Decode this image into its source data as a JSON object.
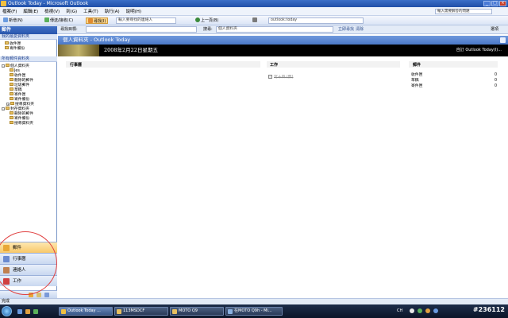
{
  "window": {
    "title": "Outlook Today - Microsoft Outlook"
  },
  "menu": {
    "items": [
      "檔案(F)",
      "編輯(E)",
      "檢視(V)",
      "到(G)",
      "工具(T)",
      "執行(A)",
      "說明(H)"
    ],
    "help_placeholder": "輸入需要解答的問題"
  },
  "toolbar": {
    "new_label": "新增(N)",
    "reply_label": "傳送/接收(C)",
    "find_label": "尋找(I)",
    "contact_placeholder": "輸入要尋找的連絡人",
    "back_label": "上一頁(B)",
    "address_value": "outlook:today"
  },
  "searchbar": {
    "search_label": "尋找目標:",
    "scope_label": "搜尋:",
    "folder_value": "個人資料夾",
    "find_now": "立即尋找",
    "clear": "清除",
    "options": "選項"
  },
  "nav": {
    "header": "郵件",
    "favorites_title": "我的最愛資料夾",
    "favorites": [
      "收件匣",
      "寄件備份"
    ],
    "all_folders_title": "所有郵件資料夾",
    "personal_root": "個人資料夾",
    "personal_items": [
      "Jes",
      "收件匣",
      "刪除的郵件",
      "垃圾郵件",
      "草稿",
      "寄件匣",
      "寄件備份",
      "搜尋資料夾"
    ],
    "archive_root": "封存資料夾",
    "archive_items": [
      "刪除的郵件",
      "寄件備份",
      "搜尋資料夾"
    ],
    "buttons": [
      "郵件",
      "行事曆",
      "連絡人",
      "工作"
    ]
  },
  "content": {
    "header": "個人資料夾 - Outlook Today",
    "date": "2008年2月22日星期五",
    "customize": "自訂 Outlook Today(I)...",
    "calendar_title": "行事曆",
    "tasks_title": "工作",
    "task_item": "寫十四 (無)",
    "messages_title": "郵件",
    "messages": [
      {
        "label": "收件匣",
        "count": "0"
      },
      {
        "label": "草稿",
        "count": "0"
      },
      {
        "label": "寄件匣",
        "count": "0"
      }
    ]
  },
  "status": {
    "text": "完成"
  },
  "taskbar": {
    "windows": [
      "Outlook Today ...",
      "113MSDCF",
      "MOTO Q9",
      "在MOTO Q9h - Mi..."
    ],
    "watermark": "#236112",
    "lang": "CH"
  },
  "colors": {
    "accent": "#3f6fc6",
    "highlight": "#f8c86a",
    "annotation": "#e04040"
  }
}
